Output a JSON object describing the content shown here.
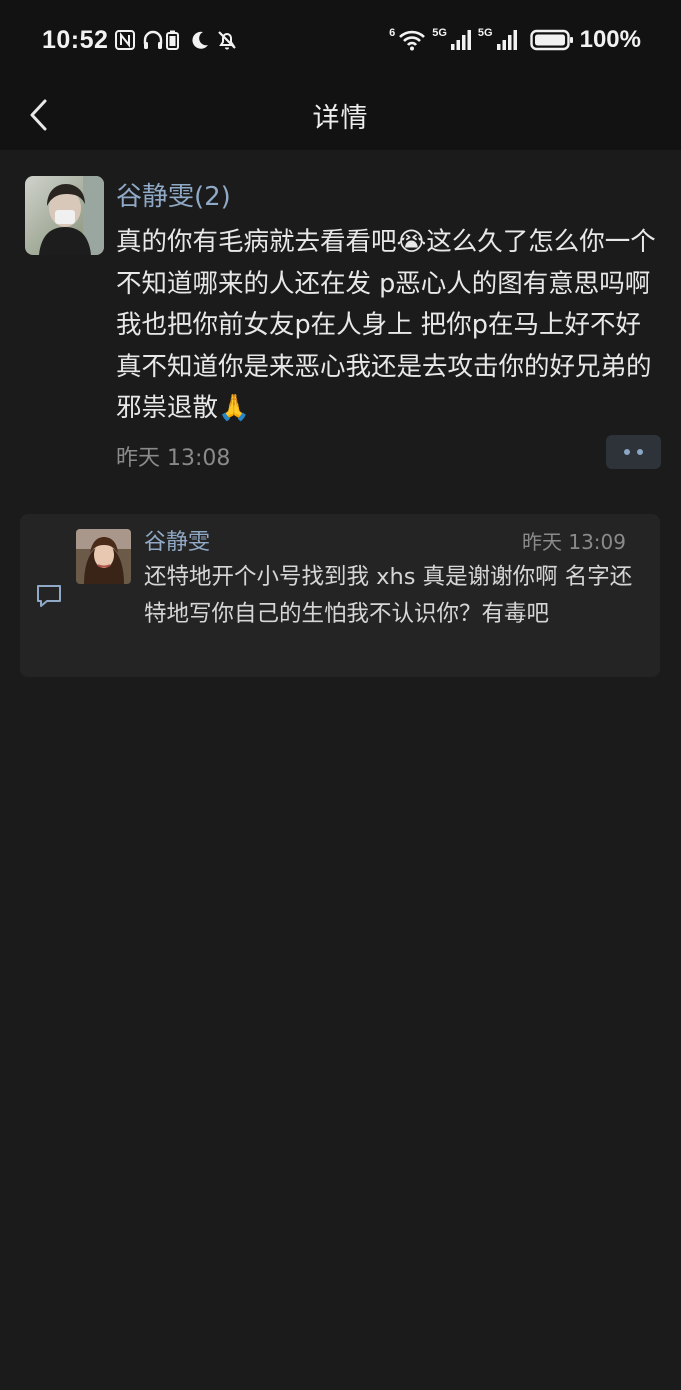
{
  "status_bar": {
    "time": "10:52",
    "battery": "100%",
    "net_labels": [
      "6",
      "5G",
      "5G"
    ],
    "icons": [
      "nfc-icon",
      "headphones-battery-icon",
      "moon-icon",
      "bell-off-icon",
      "wifi-icon",
      "signal-icon",
      "signal-icon",
      "battery-icon"
    ]
  },
  "nav": {
    "title": "详情",
    "back_icon": "chevron-left-icon"
  },
  "comment": {
    "author": "谷静雯(2)",
    "text": "真的你有毛病就去看看吧😭这么久了怎么你一个不知道哪来的人还在发 p恶心人的图有意思吗啊 我也把你前女友p在人身上 把你p在马上好不好 真不知道你是来恶心我还是去攻击你的好兄弟的 邪祟退散🙏",
    "time": "昨天 13:08",
    "more_icon": "more-dots-icon"
  },
  "reply": {
    "author": "谷静雯",
    "time": "昨天 13:09",
    "text": "还特地开个小号找到我 xhs 真是谢谢你啊 名字还特地写你自己的生怕我不认识你？有毒吧",
    "icon": "comment-bubble-icon"
  },
  "colors": {
    "background": "#1b1b1b",
    "header": "#121212",
    "accent_name": "#8fa9c6",
    "card": "#242424"
  }
}
